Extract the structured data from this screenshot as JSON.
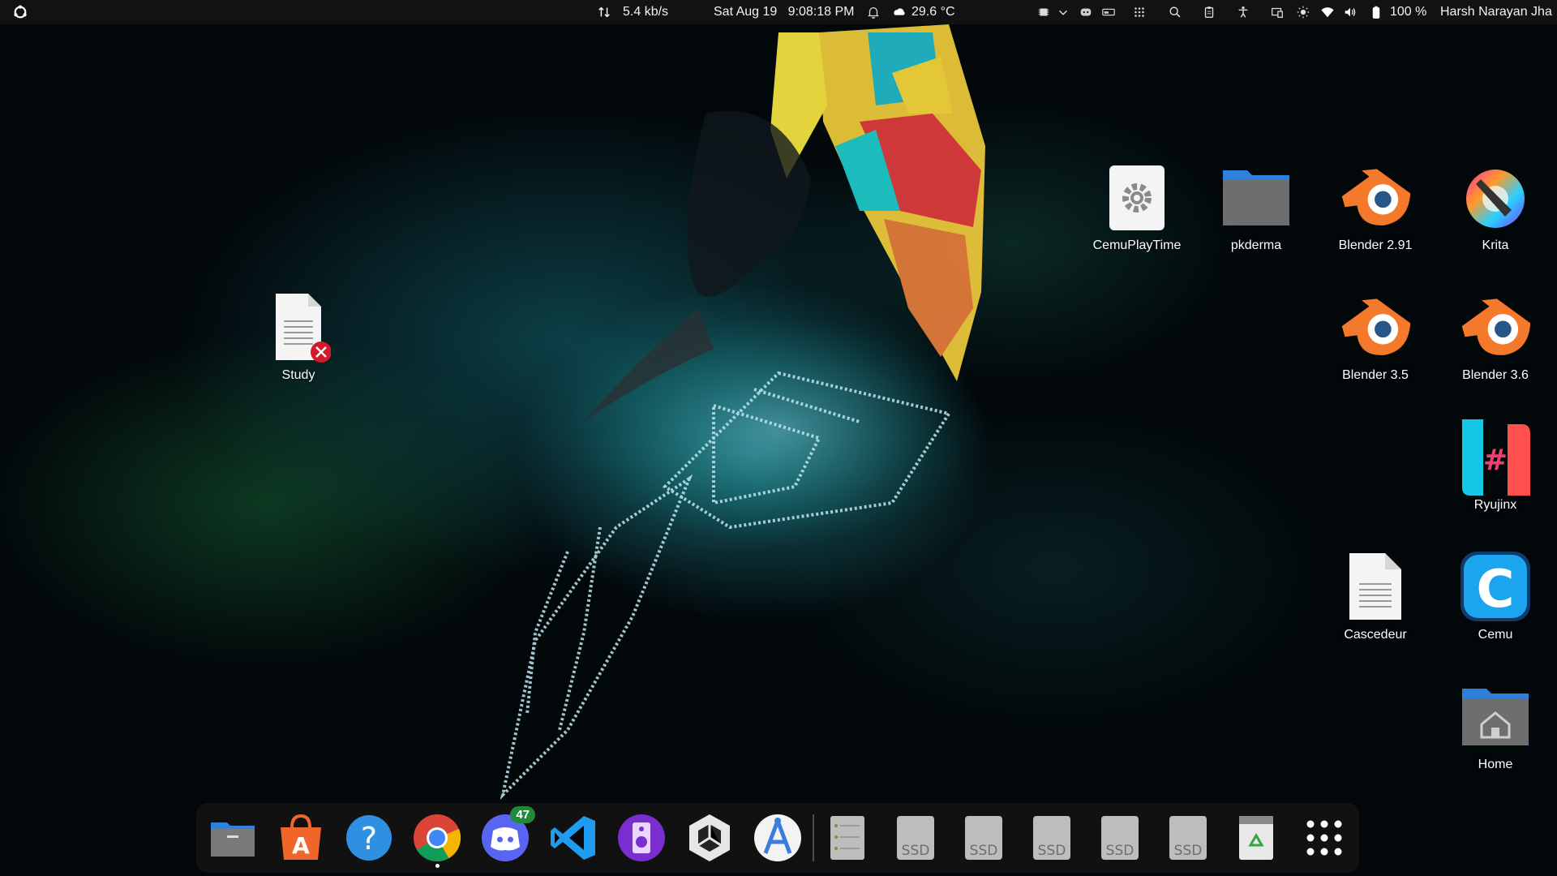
{
  "topbar": {
    "network_speed": "5.4 kb/s",
    "datetime": "Sat Aug 19   9:08:18 PM",
    "weather": "29.6 °C",
    "battery": "100 %",
    "user": "Harsh Narayan Jha"
  },
  "desktop": {
    "left_icons": [
      {
        "label": "Study",
        "icon": "text-file-broken-link-icon"
      }
    ],
    "right_icons": [
      {
        "label": "CemuPlayTime",
        "icon": "settings-app-icon"
      },
      {
        "label": "pkderma",
        "icon": "folder-icon"
      },
      {
        "label": "Blender 2.91",
        "icon": "blender-icon"
      },
      {
        "label": "Krita",
        "icon": "krita-icon"
      },
      {
        "label": "Blender 3.5",
        "icon": "blender-icon"
      },
      {
        "label": "Blender 3.6",
        "icon": "blender-icon"
      },
      {
        "label": "Ryujinx",
        "icon": "ryujinx-icon"
      },
      {
        "label": "Cascedeur",
        "icon": "text-file-icon"
      },
      {
        "label": "Cemu",
        "icon": "cemu-icon"
      },
      {
        "label": "Home",
        "icon": "home-folder-icon"
      }
    ]
  },
  "dock": {
    "discord_badge": "47",
    "ssd_label": "SSD",
    "apps": [
      "files",
      "app-center",
      "help",
      "chrome",
      "discord",
      "vscode",
      "audio-app",
      "unity",
      "android-studio",
      "disk-manager",
      "ssd-1",
      "ssd-2",
      "ssd-3",
      "ssd-4",
      "ssd-5",
      "trash",
      "show-apps"
    ]
  },
  "colors": {
    "topbar": "#121212",
    "blender_orange": "#f5792a",
    "blender_blue": "#265787",
    "folder_blue": "#3584e4"
  }
}
